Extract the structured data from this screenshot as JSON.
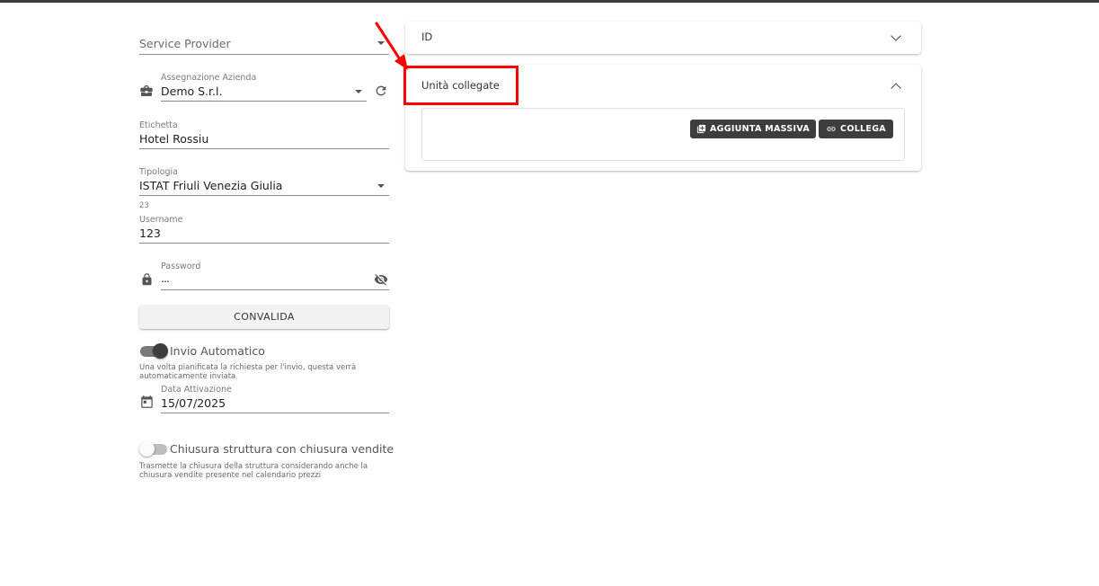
{
  "form": {
    "service_provider": {
      "placeholder": "Service Provider"
    },
    "assegnazione": {
      "label": "Assegnazione Azienda",
      "value": "Demo S.r.l."
    },
    "etichetta": {
      "label": "Etichetta",
      "value": "Hotel Rossiu"
    },
    "tipologia": {
      "label": "Tipologia",
      "value": "ISTAT Friuli Venezia Giulia"
    },
    "counter": "23",
    "username": {
      "label": "Username",
      "value": "123"
    },
    "password": {
      "label": "Password",
      "value": "..."
    },
    "convalida_label": "CONVALIDA",
    "invio": {
      "label": "Invio Automatico",
      "enabled": true,
      "helper": "Una volta pianificata la richiesta per l'invio, questa verrà automaticamente inviata"
    },
    "data_attivazione": {
      "label": "Data Attivazione",
      "value": "15/07/2025"
    },
    "chiusura": {
      "label": "Chiusura struttura con chiusura vendite",
      "enabled": false,
      "helper": "Trasmette la chiusura della struttura considerando anche la chiusura vendite presente nel calendario prezzi"
    }
  },
  "accordion": {
    "id_panel": {
      "title": "ID",
      "expanded": false
    },
    "unita_panel": {
      "title": "Unità collegate",
      "expanded": true,
      "aggiunta_label": "AGGIUNTA MASSIVA",
      "collega_label": "COLLEGA"
    }
  },
  "colors": {
    "annotation": "#ff0000",
    "toggle_on_track": "#7a7a7a",
    "toggle_on_knob": "#3d3d3d",
    "dark_button": "#3d3d3d"
  }
}
